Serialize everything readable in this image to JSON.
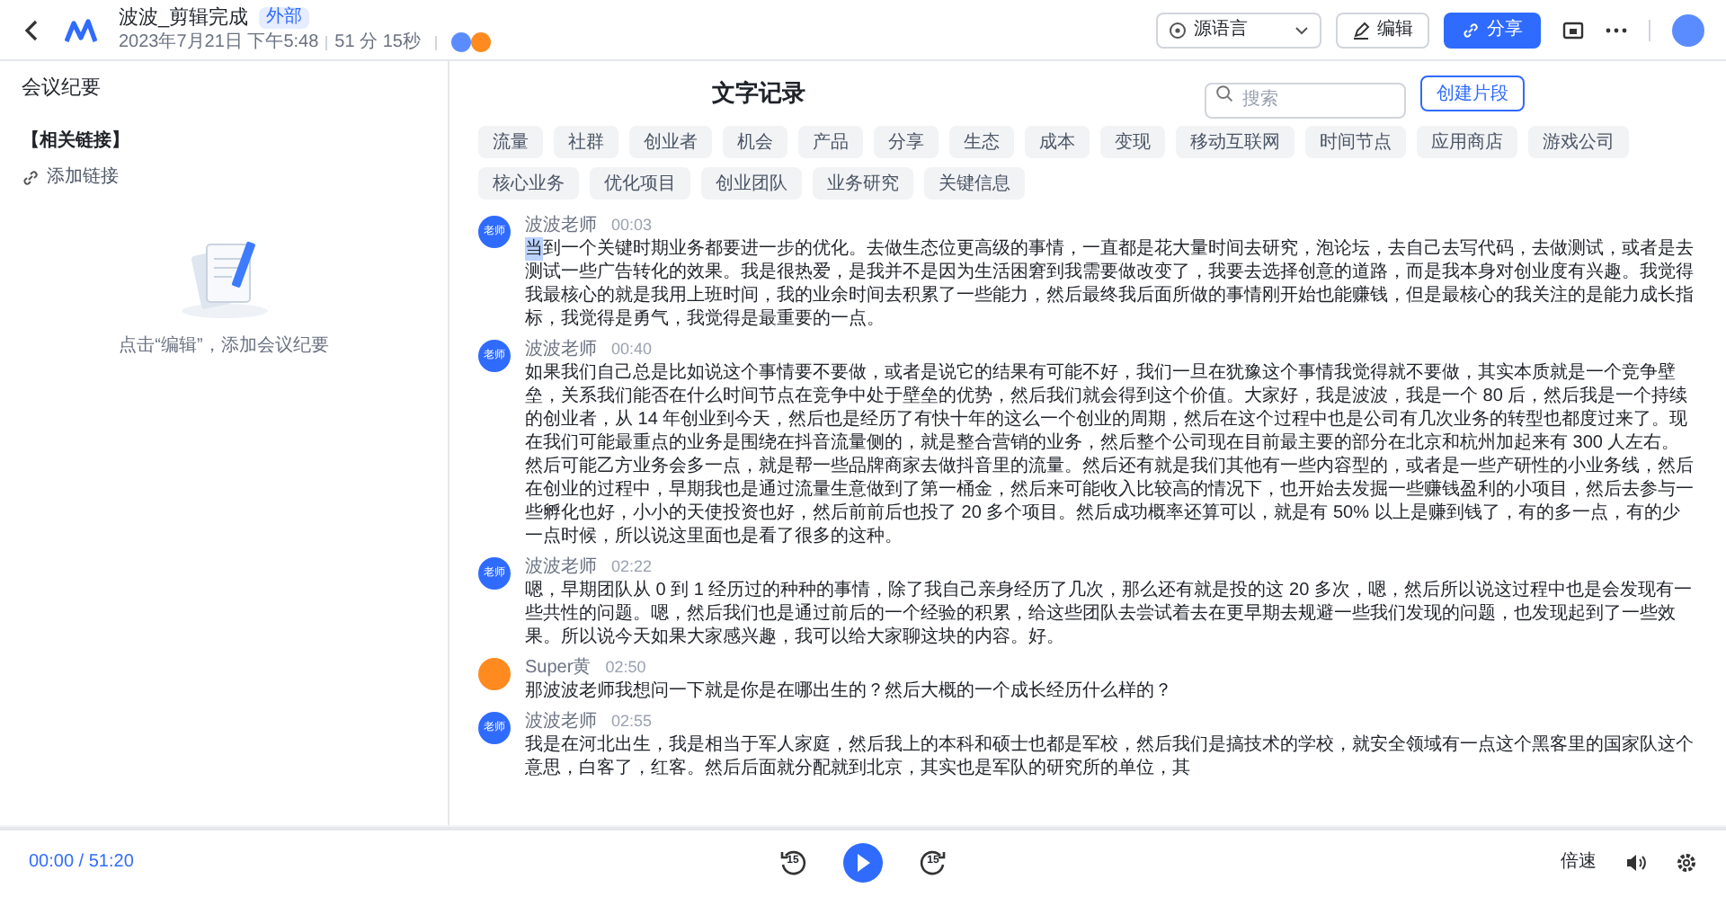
{
  "header": {
    "title": "波波_剪辑完成",
    "badge": "外部",
    "date": "2023年7月21日 下午5:48",
    "duration": "51 分 15秒",
    "language": "源语言",
    "edit": "编辑",
    "share": "分享"
  },
  "sidebar": {
    "title": "会议纪要",
    "links_heading": "【相关链接】",
    "add_link": "添加链接",
    "empty_hint": "点击“编辑”，添加会议纪要"
  },
  "transcript": {
    "title": "文字记录",
    "search": {
      "placeholder": "搜索"
    },
    "create_clip": "创建片段",
    "tags": [
      "流量",
      "社群",
      "创业者",
      "机会",
      "产品",
      "分享",
      "生态",
      "成本",
      "变现",
      "移动互联网",
      "时间节点",
      "应用商店",
      "游戏公司",
      "核心业务",
      "优化项目",
      "创业团队",
      "业务研究",
      "关键信息"
    ],
    "paragraphs": [
      {
        "speaker": "波波老师",
        "avatar": "老师",
        "color": "#2f6bff",
        "time": "00:03",
        "playing": true,
        "text": "当到一个关键时期业务都要进一步的优化。去做生态位更高级的事情，一直都是花大量时间去研究，泡论坛，去自己去写代码，去做测试，或者是去测试一些广告转化的效果。我是很热爱，是我并不是因为生活困窘到我需要做改变了，我要去选择创意的道路，而是我本身对创业度有兴趣。我觉得我最核心的就是我用上班时间，我的业余时间去积累了一些能力，然后最终我后面所做的事情刚开始也能赚钱，但是最核心的我关注的是能力成长指标，我觉得是勇气，我觉得是最重要的一点。"
      },
      {
        "speaker": "波波老师",
        "avatar": "老师",
        "color": "#2f6bff",
        "time": "00:40",
        "playing": false,
        "text": "如果我们自己总是比如说这个事情要不要做，或者是说它的结果有可能不好，我们一旦在犹豫这个事情我觉得就不要做，其实本质就是一个竞争壁垒，关系我们能否在什么时间节点在竞争中处于壁垒的优势，然后我们就会得到这个价值。大家好，我是波波，我是一个 80 后，然后我是一个持续的创业者，从 14 年创业到今天，然后也是经历了有快十年的这么一个创业的周期，然后在这个过程中也是公司有几次业务的转型也都度过来了。现在我们可能最重点的业务是围绕在抖音流量侧的，就是整合营销的业务，然后整个公司现在目前最主要的部分在北京和杭州加起来有 300 人左右。然后可能乙方业务会多一点，就是帮一些品牌商家去做抖音里的流量。然后还有就是我们其他有一些内容型的，或者是一些产研性的小业务线，然后在创业的过程中，早期我也是通过流量生意做到了第一桶金，然后来可能收入比较高的情况下，也开始去发掘一些赚钱盈利的小项目，然后去参与一些孵化也好，小小的天使投资也好，然后前前后也投了 20 多个项目。然后成功概率还算可以，就是有 50% 以上是赚到钱了，有的多一点，有的少一点时候，所以说这里面也是看了很多的这种。"
      },
      {
        "speaker": "波波老师",
        "avatar": "老师",
        "color": "#2f6bff",
        "time": "02:22",
        "playing": false,
        "text": "嗯，早期团队从 0 到 1 经历过的种种的事情，除了我自己亲身经历了几次，那么还有就是投的这 20 多次，嗯，然后所以说这过程中也是会发现有一些共性的问题。嗯，然后我们也是通过前后的一个经验的积累，给这些团队去尝试着去在更早期去规避一些我们发现的问题，也发现起到了一些效果。所以说今天如果大家感兴趣，我可以给大家聊这块的内容。好。"
      },
      {
        "speaker": "Super黄",
        "color": "#ff8a1f",
        "time": "02:50",
        "playing": false,
        "text": "那波波老师我想问一下就是你是在哪出生的？然后大概的一个成长经历什么样的？"
      },
      {
        "speaker": "波波老师",
        "avatar": "老师",
        "color": "#2f6bff",
        "time": "02:55",
        "playing": false,
        "text": "我是在河北出生，我是相当于军人家庭，然后我上的本科和硕士也都是军校，然后我们是搞技术的学校，就安全领域有一点这个黑客里的国家队这个意思，白客了，红客。然后后面就分配就到北京，其实也是军队的研究所的单位，其"
      }
    ]
  },
  "player": {
    "time": "00:00 / 51:20",
    "rewind": "15",
    "forward": "15",
    "speed": "倍速"
  }
}
